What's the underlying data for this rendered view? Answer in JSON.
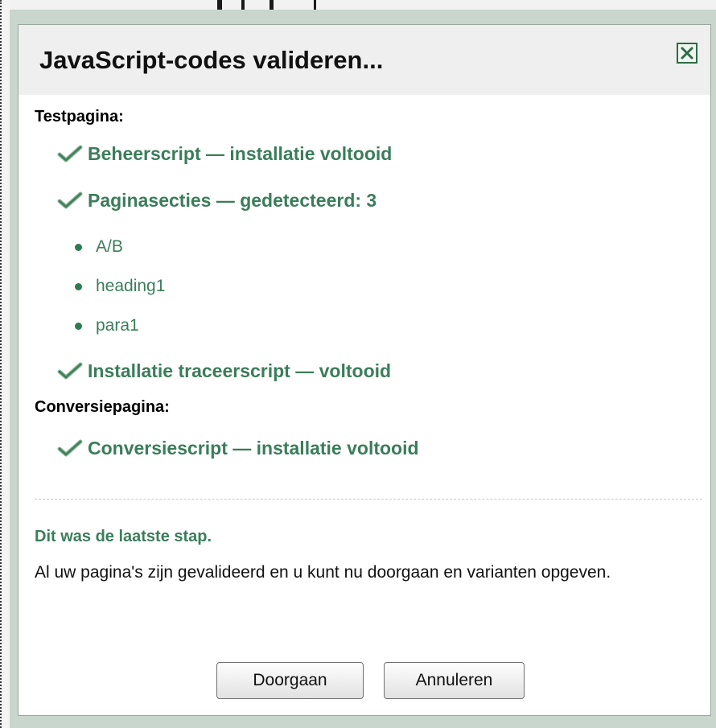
{
  "dialog": {
    "title": "JavaScript-codes valideren...",
    "close_icon": "close-icon"
  },
  "test_page": {
    "heading": "Testpagina:",
    "items": [
      {
        "icon": "checkmark-icon",
        "text": "Beheerscript — installatie voltooid"
      },
      {
        "icon": "checkmark-icon",
        "text": "Paginasecties — gedetecteerd: 3"
      }
    ],
    "sections": [
      "A/B",
      "heading1",
      "para1"
    ],
    "tracking": {
      "icon": "checkmark-icon",
      "text": "Installatie traceerscript — voltooid"
    }
  },
  "conversion_page": {
    "heading": "Conversiepagina:",
    "item": {
      "icon": "checkmark-icon",
      "text": "Conversiescript — installatie voltooid"
    }
  },
  "final": {
    "title": "Dit was de laatste stap.",
    "text": "Al uw pagina's zijn gevalideerd en u kunt nu doorgaan en varianten opgeven."
  },
  "buttons": {
    "continue_label": "Doorgaan",
    "cancel_label": "Annuleren"
  },
  "colors": {
    "accent": "#3b7d5a",
    "titlebar": "#efefef",
    "background": "#c9d6cd"
  }
}
